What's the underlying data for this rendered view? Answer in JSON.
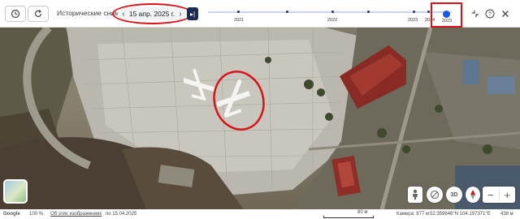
{
  "topbar": {
    "history_label": "Исторические снимки",
    "date_value": "15 апр. 2025 г.",
    "prev_arrow": "‹",
    "next_arrow": "›",
    "skip_latest": "▸|",
    "timeline_years": [
      "2021",
      "2022",
      "2023",
      "2024"
    ],
    "selected_year": "2023",
    "highlight_color": "#d8141a",
    "selected_color": "#1a5be6"
  },
  "statusbar": {
    "brand": "Google",
    "zoom": "100 %",
    "about_images": "Об этих изображениях",
    "image_date": "по 15.04.2025",
    "scale": "80 м",
    "camera": "Камера: 877 м",
    "coords": "52.359846°N 104.197371°E",
    "altitude": "438 м"
  },
  "controls": {
    "label_3d": "3D",
    "zoom_in": "+",
    "zoom_out": "−"
  }
}
